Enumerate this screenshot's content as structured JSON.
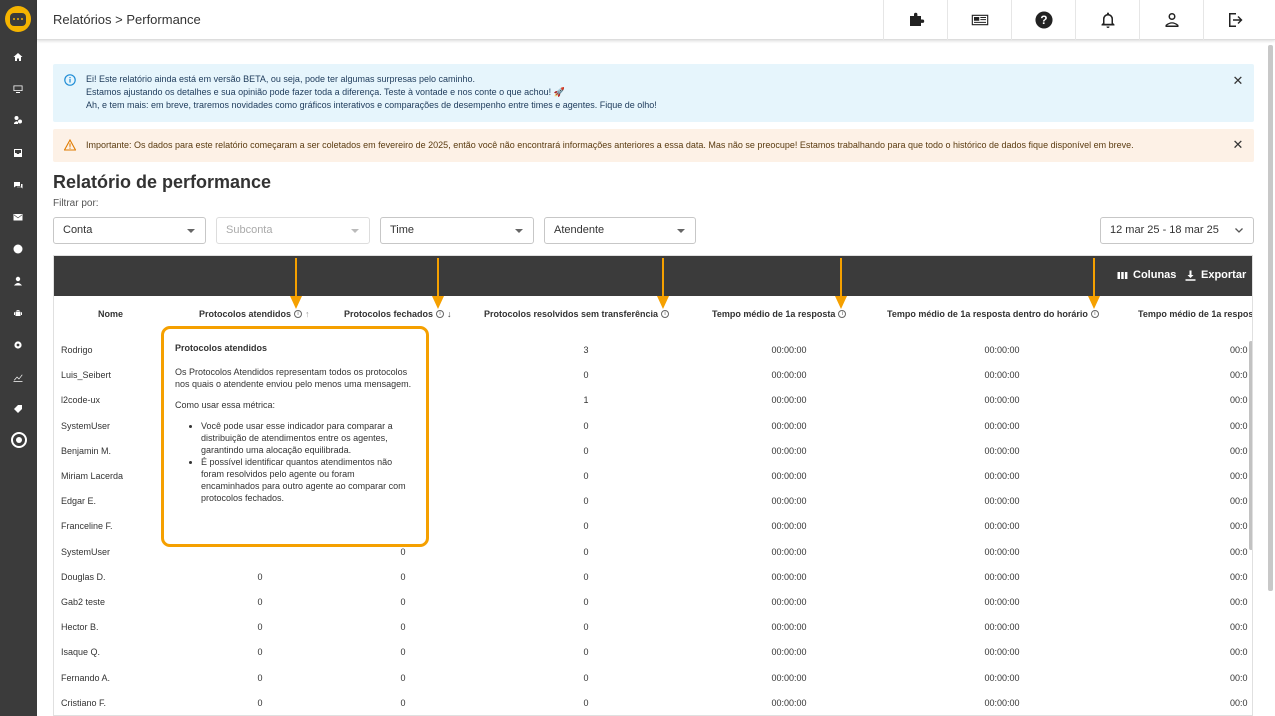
{
  "sidebar": {
    "icons": [
      "home-icon",
      "monitor-icon",
      "contacts-icon",
      "inbox-icon",
      "chat-icon",
      "mail-icon",
      "alert-icon",
      "user-icon",
      "android-icon",
      "settings-icon",
      "chart-icon",
      "tag-icon",
      "reports-icon"
    ]
  },
  "header": {
    "breadcrumb": "Relatórios > Performance",
    "icons": [
      "puzzle-icon",
      "news-icon",
      "help-icon",
      "bell-icon",
      "profile-icon",
      "logout-icon"
    ]
  },
  "banners": {
    "info_line1": "Ei! Este relatório ainda está em versão BETA, ou seja, pode ter algumas surpresas pelo caminho.",
    "info_line2": "Estamos ajustando os detalhes e sua opinião pode fazer toda a diferença. Teste à vontade e nos conte o que achou! 🚀",
    "info_line3": "Ah, e tem mais: em breve, traremos novidades como gráficos interativos e comparações de desempenho entre times e agentes. Fique de olho!",
    "warn_text": "Importante: Os dados para este relatório começaram a ser coletados em fevereiro de 2025, então você não encontrará informações anteriores a essa data. Mas não se preocupe! Estamos trabalhando para que todo o histórico de dados fique disponível em breve.",
    "close_symbol": "✕"
  },
  "page": {
    "title": "Relatório de performance",
    "filter_label": "Filtrar por:"
  },
  "filters": {
    "conta": "Conta",
    "subconta": "Subconta",
    "time": "Time",
    "atendente": "Atendente",
    "date_range": "12 mar 25 - 18 mar 25"
  },
  "toolbar": {
    "columns_label": "Colunas",
    "export_label": "Exportar"
  },
  "table": {
    "headers": {
      "nome": "Nome",
      "protocolos_atendidos": "Protocolos atendidos",
      "protocolos_fechados": "Protocolos fechados",
      "resolvidos_sem_transferencia": "Protocolos resolvidos sem transferência",
      "tempo_medio_1a_resposta": "Tempo médio de 1a resposta",
      "tempo_medio_1a_resposta_horario": "Tempo médio de 1a resposta dentro do horário",
      "tempo_medio_1a_resposta_cut": "Tempo médio de 1a respos"
    },
    "rows": [
      {
        "nome": "Rodrigo",
        "atendidos": "",
        "fechados": "",
        "resolvidos": "3",
        "tempo": "00:00:00",
        "tempo_horario": "00:00:00",
        "tempo_cut": "00:0"
      },
      {
        "nome": "Luis_Seibert",
        "atendidos": "",
        "fechados": "",
        "resolvidos": "0",
        "tempo": "00:00:00",
        "tempo_horario": "00:00:00",
        "tempo_cut": "00:0"
      },
      {
        "nome": "l2code-ux",
        "atendidos": "",
        "fechados": "",
        "resolvidos": "1",
        "tempo": "00:00:00",
        "tempo_horario": "00:00:00",
        "tempo_cut": "00:0"
      },
      {
        "nome": "SystemUser",
        "atendidos": "",
        "fechados": "",
        "resolvidos": "0",
        "tempo": "00:00:00",
        "tempo_horario": "00:00:00",
        "tempo_cut": "00:0"
      },
      {
        "nome": "Benjamin M.",
        "atendidos": "",
        "fechados": "",
        "resolvidos": "0",
        "tempo": "00:00:00",
        "tempo_horario": "00:00:00",
        "tempo_cut": "00:0"
      },
      {
        "nome": "Miriam Lacerda",
        "atendidos": "",
        "fechados": "",
        "resolvidos": "0",
        "tempo": "00:00:00",
        "tempo_horario": "00:00:00",
        "tempo_cut": "00:0"
      },
      {
        "nome": "Edgar E.",
        "atendidos": "",
        "fechados": "",
        "resolvidos": "0",
        "tempo": "00:00:00",
        "tempo_horario": "00:00:00",
        "tempo_cut": "00:0"
      },
      {
        "nome": "Franceline F.",
        "atendidos": "",
        "fechados": "",
        "resolvidos": "0",
        "tempo": "00:00:00",
        "tempo_horario": "00:00:00",
        "tempo_cut": "00:0"
      },
      {
        "nome": "SystemUser",
        "atendidos": "",
        "fechados": "0",
        "resolvidos": "0",
        "tempo": "00:00:00",
        "tempo_horario": "00:00:00",
        "tempo_cut": "00:0"
      },
      {
        "nome": "Douglas D.",
        "atendidos": "0",
        "fechados": "0",
        "resolvidos": "0",
        "tempo": "00:00:00",
        "tempo_horario": "00:00:00",
        "tempo_cut": "00:0"
      },
      {
        "nome": "Gab2 teste",
        "atendidos": "0",
        "fechados": "0",
        "resolvidos": "0",
        "tempo": "00:00:00",
        "tempo_horario": "00:00:00",
        "tempo_cut": "00:0"
      },
      {
        "nome": "Hector B.",
        "atendidos": "0",
        "fechados": "0",
        "resolvidos": "0",
        "tempo": "00:00:00",
        "tempo_horario": "00:00:00",
        "tempo_cut": "00:0"
      },
      {
        "nome": "Isaque Q.",
        "atendidos": "0",
        "fechados": "0",
        "resolvidos": "0",
        "tempo": "00:00:00",
        "tempo_horario": "00:00:00",
        "tempo_cut": "00:0"
      },
      {
        "nome": "Fernando A.",
        "atendidos": "0",
        "fechados": "0",
        "resolvidos": "0",
        "tempo": "00:00:00",
        "tempo_horario": "00:00:00",
        "tempo_cut": "00:0"
      },
      {
        "nome": "Cristiano F.",
        "atendidos": "0",
        "fechados": "0",
        "resolvidos": "0",
        "tempo": "00:00:00",
        "tempo_horario": "00:00:00",
        "tempo_cut": "00:0"
      }
    ]
  },
  "tooltip": {
    "title": "Protocolos atendidos",
    "para1": "Os Protocolos Atendidos representam todos os protocolos nos quais o atendente enviou pelo menos uma mensagem.",
    "para2": "Como usar essa métrica:",
    "bullet1": "Você pode usar esse indicador para comparar a distribuição de atendimentos entre os agentes, garantindo uma alocação equilibrada.",
    "bullet2": "É possível identificar quantos atendimentos não foram resolvidos pelo agente ou foram encaminhados para outro agente ao comparar com protocolos fechados."
  },
  "colors": {
    "sidebar": "#3b3b3b",
    "brand_yellow": "#f5b400",
    "annotation_orange": "#f5a000",
    "info_bg": "#e6f5fc",
    "warn_bg": "#fdf1e6"
  }
}
